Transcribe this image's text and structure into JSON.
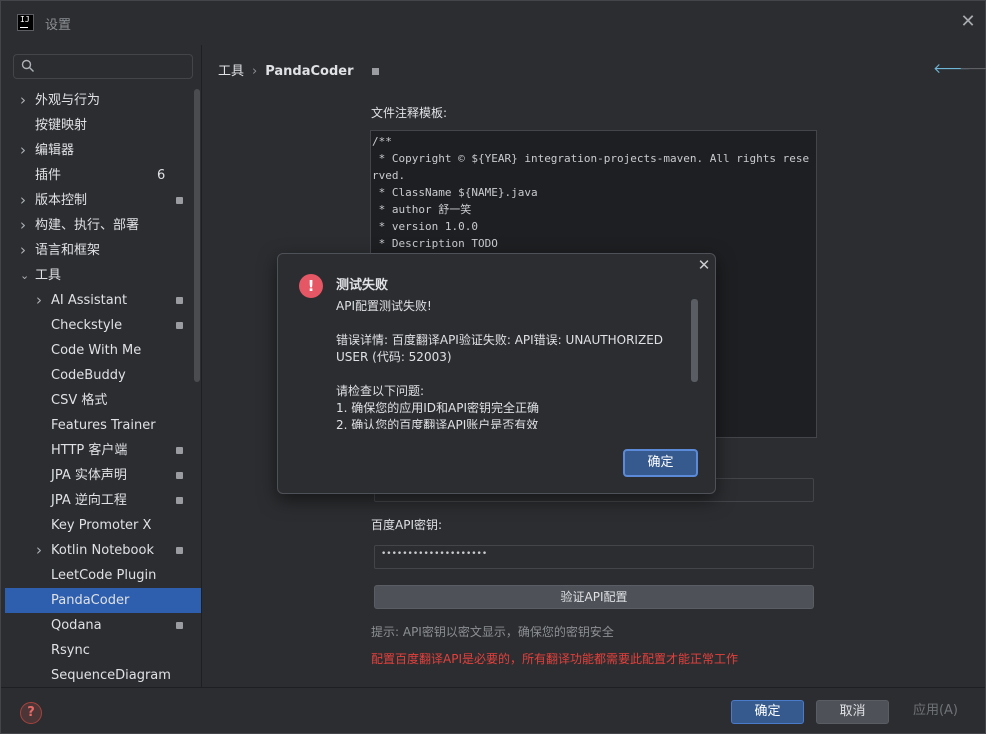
{
  "window": {
    "title": "设置"
  },
  "search": {
    "placeholder": ""
  },
  "sidebar": {
    "items": [
      {
        "label": "外观与行为",
        "expandable": true,
        "indent": 0
      },
      {
        "label": "按键映射",
        "expandable": false,
        "indent": 0
      },
      {
        "label": "编辑器",
        "expandable": true,
        "indent": 0
      },
      {
        "label": "插件",
        "expandable": false,
        "indent": 0,
        "count": "6"
      },
      {
        "label": "版本控制",
        "expandable": true,
        "indent": 0,
        "badge": true
      },
      {
        "label": "构建、执行、部署",
        "expandable": true,
        "indent": 0
      },
      {
        "label": "语言和框架",
        "expandable": true,
        "indent": 0
      },
      {
        "label": "工具",
        "expandable": true,
        "expanded": true,
        "indent": 0
      },
      {
        "label": "AI Assistant",
        "expandable": true,
        "indent": 1,
        "badge": true
      },
      {
        "label": "Checkstyle",
        "expandable": false,
        "indent": 1,
        "badge": true
      },
      {
        "label": "Code With Me",
        "expandable": false,
        "indent": 1
      },
      {
        "label": "CodeBuddy",
        "expandable": false,
        "indent": 1
      },
      {
        "label": "CSV 格式",
        "expandable": false,
        "indent": 1
      },
      {
        "label": "Features Trainer",
        "expandable": false,
        "indent": 1
      },
      {
        "label": "HTTP 客户端",
        "expandable": false,
        "indent": 1,
        "badge": true
      },
      {
        "label": "JPA 实体声明",
        "expandable": false,
        "indent": 1,
        "badge": true
      },
      {
        "label": "JPA 逆向工程",
        "expandable": false,
        "indent": 1,
        "badge": true
      },
      {
        "label": "Key Promoter X",
        "expandable": false,
        "indent": 1
      },
      {
        "label": "Kotlin Notebook",
        "expandable": true,
        "indent": 1,
        "badge": true
      },
      {
        "label": "LeetCode Plugin",
        "expandable": false,
        "indent": 1
      },
      {
        "label": "PandaCoder",
        "expandable": false,
        "indent": 1,
        "selected": true
      },
      {
        "label": "Qodana",
        "expandable": false,
        "indent": 1,
        "badge": true
      },
      {
        "label": "Rsync",
        "expandable": false,
        "indent": 1
      },
      {
        "label": "SequenceDiagram",
        "expandable": false,
        "indent": 1
      }
    ]
  },
  "breadcrumb": {
    "parent": "工具",
    "separator": "›",
    "current": "PandaCoder"
  },
  "content": {
    "template_label": "文件注释模板:",
    "template_text": "/**\n * Copyright © ${YEAR} integration-projects-maven. All rights reserved.\n * ClassName ${NAME}.java\n * author 舒一笑\n * version 1.0.0\n * Description TODO",
    "secret_label": "百度API密钥:",
    "secret_value": "••••••••••••••••••••",
    "verify_button": "验证API配置",
    "hint": "提示: API密钥以密文显示，确保您的密钥安全",
    "warning": "配置百度翻译API是必要的，所有翻译功能都需要此配置才能正常工作"
  },
  "footer": {
    "ok": "确定",
    "cancel": "取消",
    "apply": "应用(A)",
    "help": "?"
  },
  "modal": {
    "title": "测试失败",
    "line1": "API配置测试失败!",
    "line2": "错误详情: 百度翻译API验证失败: API错误: UNAUTHORIZED USER (代码: 52003)",
    "line3": "请检查以下问题:",
    "line4": "1. 确保您的应用ID和API密钥完全正确",
    "line5": "2. 确认您的百度翻译API账户是否有效",
    "ok": "确定"
  },
  "colors": {
    "accent": "#2e5fae",
    "error": "#e55765",
    "warning_text": "#e5403c"
  }
}
